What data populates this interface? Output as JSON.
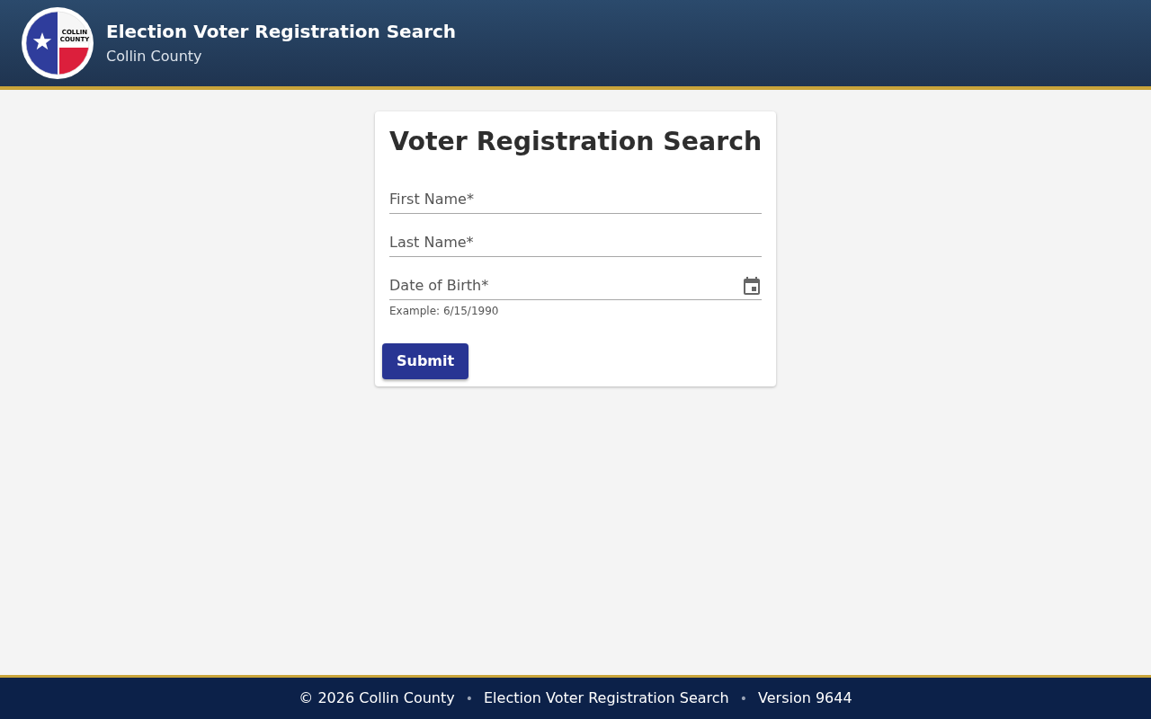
{
  "header": {
    "logo": {
      "text_lines": [
        "COLLIN",
        "COUNTY"
      ]
    },
    "title": "Election Voter Registration Search",
    "subtitle": "Collin County"
  },
  "search_card": {
    "title": "Voter Registration Search",
    "fields": [
      {
        "kind": "text",
        "placeholder": "First Name*"
      },
      {
        "kind": "text",
        "placeholder": "Last Name*"
      },
      {
        "kind": "date",
        "placeholder": "Date of Birth*",
        "hint": "Example: 6/15/1990"
      }
    ],
    "submit_button": "Submit"
  },
  "footer": {
    "parts": [
      {
        "kind": "text",
        "text": "© 2026 Collin County"
      },
      {
        "kind": "separator",
        "text": "•"
      },
      {
        "kind": "text",
        "text": "Election Voter Registration Search"
      },
      {
        "kind": "separator",
        "text": "•"
      },
      {
        "kind": "text",
        "text": "Version 9644"
      }
    ]
  }
}
